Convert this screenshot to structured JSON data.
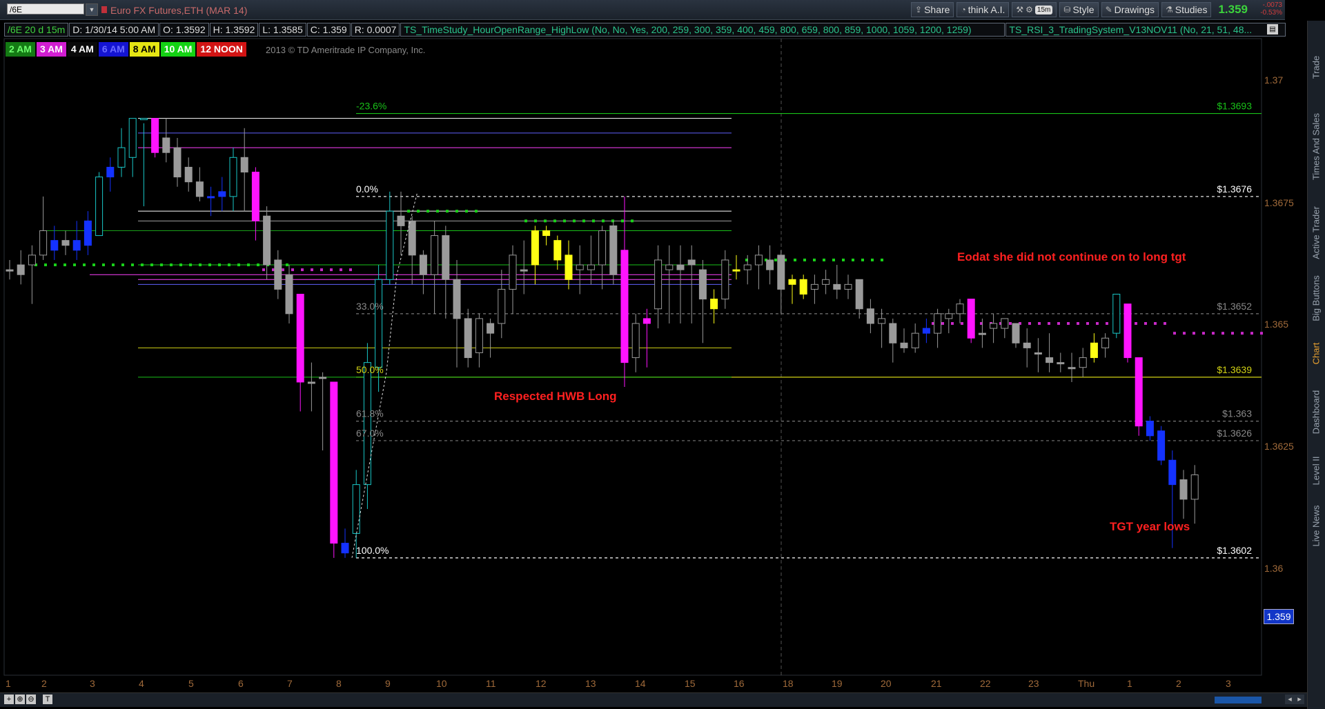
{
  "toolbar": {
    "symbol": "/6E",
    "instrument_title": "Euro FX Futures,ETH (MAR 14)",
    "share_label": "Share",
    "think_label": "think A.I.",
    "timeframe_badge": "15m",
    "style_label": "Style",
    "drawings_label": "Drawings",
    "studies_label": "Studies",
    "last_price": "1.359",
    "net_change": "-.0073",
    "pct_change": "-0.53%"
  },
  "infobar": {
    "period": "/6E 20 d 15m",
    "date": "D: 1/30/14 5:00 AM",
    "open": "O: 1.3592",
    "high": "H: 1.3592",
    "low": "L: 1.3585",
    "close": "C: 1.359",
    "range": "R: 0.0007",
    "study1": "TS_TimeStudy_HourOpenRange_HighLow (No, No, Yes, 200, 259, 300, 359, 400, 459, 800, 659, 800, 859, 1000, 1059, 1200, 1259)",
    "study2": "TS_RSI_3_TradingSystem_V13NOV11 (No, 21, 51, 48..."
  },
  "sessions": [
    {
      "label": "2 AM",
      "bg": "#147a14",
      "fg": "#6dff6d"
    },
    {
      "label": "3 AM",
      "bg": "#d21ed2",
      "fg": "#ffffff"
    },
    {
      "label": "4 AM",
      "bg": "#0a0a0a",
      "fg": "#ffffff"
    },
    {
      "label": "6 AM",
      "bg": "#1414d2",
      "fg": "#6a6aff"
    },
    {
      "label": "8 AM",
      "bg": "#e6e614",
      "fg": "#000000"
    },
    {
      "label": "10 AM",
      "bg": "#14d214",
      "fg": "#ffffff"
    },
    {
      "label": "12 NOON",
      "bg": "#d21414",
      "fg": "#ffffff"
    }
  ],
  "copyright": "2013 © TD Ameritrade IP Company, Inc.",
  "colors": {
    "up_candle": "#19c8c8",
    "down_candle": "#ff14ff",
    "neutral_candle": "#9a9a9a",
    "yellow_candle": "#ffff14",
    "blue_candle": "#1432ff",
    "fib_green": "#19c219",
    "fib_yellow": "#d2d214",
    "annotation_red": "#ff2020",
    "axis_text": "#a06a3a"
  },
  "fib_labels": {
    "ext": "-23.6%",
    "zero": "0.0%",
    "p33": "33.0%",
    "p50": "50.0%",
    "p618": "61.8%",
    "p67": "67.0%",
    "p100": "100.0%"
  },
  "fib_prices": {
    "ext": "$1.3693",
    "zero": "$1.3676",
    "p33": "$1.3652",
    "p50": "$1.3639",
    "p618": "$1.363",
    "p67": "$1.3626",
    "p100": "$1.3602"
  },
  "annotations": {
    "hwb": "Respected HWB Long",
    "eodat": "Eodat she did not continue on to long tgt",
    "tgt": "TGT year lows"
  },
  "price_axis": [
    "1.37",
    "1.3675",
    "1.365",
    "1.3625",
    "1.36"
  ],
  "price_tag": "1.359",
  "x_axis": [
    "1",
    "2",
    "3",
    "4",
    "5",
    "6",
    "7",
    "8",
    "9",
    "10",
    "11",
    "12",
    "13",
    "14",
    "15",
    "16",
    "18",
    "19",
    "20",
    "21",
    "22",
    "23",
    "Thu",
    "1",
    "2",
    "3"
  ],
  "right_tabs": [
    "Trade",
    "Times And Sales",
    "Active Trader",
    "Big Buttons",
    "Chart",
    "Dashboard",
    "Level II",
    "Live News"
  ],
  "bottom_buttons": [
    "+",
    "⊕",
    "⊖",
    "T"
  ],
  "chart_data": {
    "type": "candlestick",
    "ylim": [
      1.3578,
      1.3715
    ],
    "candles": [
      {
        "o": 1.3661,
        "h": 1.3663,
        "l": 1.3659,
        "c": 1.3661,
        "col": "n"
      },
      {
        "o": 1.3662,
        "h": 1.3665,
        "l": 1.3658,
        "c": 1.366,
        "col": "n"
      },
      {
        "o": 1.3662,
        "h": 1.3666,
        "l": 1.3654,
        "c": 1.3664,
        "col": "n"
      },
      {
        "o": 1.3664,
        "h": 1.3676,
        "l": 1.3663,
        "c": 1.3669,
        "col": "n"
      },
      {
        "o": 1.3665,
        "h": 1.367,
        "l": 1.3663,
        "c": 1.3667,
        "col": "b"
      },
      {
        "o": 1.3667,
        "h": 1.3669,
        "l": 1.3664,
        "c": 1.3666,
        "col": "n"
      },
      {
        "o": 1.3665,
        "h": 1.3671,
        "l": 1.3663,
        "c": 1.3667,
        "col": "b"
      },
      {
        "o": 1.3666,
        "h": 1.3673,
        "l": 1.3664,
        "c": 1.3671,
        "col": "b"
      },
      {
        "o": 1.3668,
        "h": 1.3681,
        "l": 1.3668,
        "c": 1.368,
        "col": "u"
      },
      {
        "o": 1.368,
        "h": 1.3684,
        "l": 1.3677,
        "c": 1.3682,
        "col": "b"
      },
      {
        "o": 1.3682,
        "h": 1.369,
        "l": 1.368,
        "c": 1.3686,
        "col": "u"
      },
      {
        "o": 1.3684,
        "h": 1.3692,
        "l": 1.368,
        "c": 1.3692,
        "col": "u"
      },
      {
        "o": 1.3692,
        "h": 1.3691,
        "l": 1.3674,
        "c": 1.3692,
        "col": "u"
      },
      {
        "o": 1.3692,
        "h": 1.3692,
        "l": 1.3684,
        "c": 1.3685,
        "col": "d"
      },
      {
        "o": 1.3688,
        "h": 1.3692,
        "l": 1.3683,
        "c": 1.3685,
        "col": "n"
      },
      {
        "o": 1.3686,
        "h": 1.3688,
        "l": 1.3678,
        "c": 1.368,
        "col": "n"
      },
      {
        "o": 1.3682,
        "h": 1.3684,
        "l": 1.3677,
        "c": 1.3679,
        "col": "n"
      },
      {
        "o": 1.3679,
        "h": 1.3682,
        "l": 1.3675,
        "c": 1.3676,
        "col": "n"
      },
      {
        "o": 1.3676,
        "h": 1.3678,
        "l": 1.3672,
        "c": 1.3676,
        "col": "b"
      },
      {
        "o": 1.3676,
        "h": 1.368,
        "l": 1.3673,
        "c": 1.3677,
        "col": "b"
      },
      {
        "o": 1.3676,
        "h": 1.3686,
        "l": 1.3673,
        "c": 1.3684,
        "col": "u"
      },
      {
        "o": 1.3684,
        "h": 1.369,
        "l": 1.3673,
        "c": 1.3681,
        "col": "n"
      },
      {
        "o": 1.3681,
        "h": 1.3682,
        "l": 1.3667,
        "c": 1.3671,
        "col": "d"
      },
      {
        "o": 1.3672,
        "h": 1.3674,
        "l": 1.3659,
        "c": 1.3662,
        "col": "n"
      },
      {
        "o": 1.3663,
        "h": 1.3665,
        "l": 1.3655,
        "c": 1.3657,
        "col": "n"
      },
      {
        "o": 1.366,
        "h": 1.3662,
        "l": 1.365,
        "c": 1.3652,
        "col": "n"
      },
      {
        "o": 1.3656,
        "h": 1.3656,
        "l": 1.3632,
        "c": 1.3638,
        "col": "d"
      },
      {
        "o": 1.3638,
        "h": 1.3642,
        "l": 1.3632,
        "c": 1.3638,
        "col": "n"
      },
      {
        "o": 1.3639,
        "h": 1.364,
        "l": 1.3624,
        "c": 1.3639,
        "col": "n"
      },
      {
        "o": 1.3638,
        "h": 1.3638,
        "l": 1.3602,
        "c": 1.3605,
        "col": "d"
      },
      {
        "o": 1.3603,
        "h": 1.3608,
        "l": 1.3602,
        "c": 1.3605,
        "col": "b"
      },
      {
        "o": 1.3607,
        "h": 1.362,
        "l": 1.3602,
        "c": 1.3617,
        "col": "u"
      },
      {
        "o": 1.3617,
        "h": 1.3646,
        "l": 1.3612,
        "c": 1.3642,
        "col": "u"
      },
      {
        "o": 1.3641,
        "h": 1.3662,
        "l": 1.3636,
        "c": 1.3659,
        "col": "u"
      },
      {
        "o": 1.3659,
        "h": 1.3677,
        "l": 1.3658,
        "c": 1.3673,
        "col": "u"
      },
      {
        "o": 1.3672,
        "h": 1.3677,
        "l": 1.3664,
        "c": 1.367,
        "col": "n"
      },
      {
        "o": 1.3671,
        "h": 1.3672,
        "l": 1.3658,
        "c": 1.3664,
        "col": "n"
      },
      {
        "o": 1.3664,
        "h": 1.3665,
        "l": 1.3656,
        "c": 1.366,
        "col": "n"
      },
      {
        "o": 1.366,
        "h": 1.3671,
        "l": 1.3652,
        "c": 1.3668,
        "col": "n"
      },
      {
        "o": 1.3668,
        "h": 1.367,
        "l": 1.3651,
        "c": 1.3659,
        "col": "n"
      },
      {
        "o": 1.3659,
        "h": 1.3663,
        "l": 1.3641,
        "c": 1.3651,
        "col": "n"
      },
      {
        "o": 1.3651,
        "h": 1.3653,
        "l": 1.3641,
        "c": 1.3643,
        "col": "n"
      },
      {
        "o": 1.3644,
        "h": 1.3652,
        "l": 1.3641,
        "c": 1.3651,
        "col": "n"
      },
      {
        "o": 1.365,
        "h": 1.3651,
        "l": 1.3643,
        "c": 1.3648,
        "col": "n"
      },
      {
        "o": 1.365,
        "h": 1.3661,
        "l": 1.3647,
        "c": 1.3657,
        "col": "n"
      },
      {
        "o": 1.3657,
        "h": 1.3666,
        "l": 1.3652,
        "c": 1.3664,
        "col": "n"
      },
      {
        "o": 1.3661,
        "h": 1.3667,
        "l": 1.3656,
        "c": 1.3661,
        "col": "n"
      },
      {
        "o": 1.3662,
        "h": 1.367,
        "l": 1.3658,
        "c": 1.3669,
        "col": "y"
      },
      {
        "o": 1.3669,
        "h": 1.367,
        "l": 1.3666,
        "c": 1.3668,
        "col": "y"
      },
      {
        "o": 1.3667,
        "h": 1.3668,
        "l": 1.3661,
        "c": 1.3663,
        "col": "y"
      },
      {
        "o": 1.3664,
        "h": 1.3667,
        "l": 1.3657,
        "c": 1.3659,
        "col": "y"
      },
      {
        "o": 1.3661,
        "h": 1.3666,
        "l": 1.3656,
        "c": 1.3662,
        "col": "n"
      },
      {
        "o": 1.3661,
        "h": 1.3668,
        "l": 1.3658,
        "c": 1.3662,
        "col": "n"
      },
      {
        "o": 1.3662,
        "h": 1.367,
        "l": 1.3657,
        "c": 1.3669,
        "col": "n"
      },
      {
        "o": 1.367,
        "h": 1.3671,
        "l": 1.3658,
        "c": 1.366,
        "col": "n"
      },
      {
        "o": 1.3665,
        "h": 1.3676,
        "l": 1.3637,
        "c": 1.3642,
        "col": "d"
      },
      {
        "o": 1.3643,
        "h": 1.3652,
        "l": 1.364,
        "c": 1.365,
        "col": "n"
      },
      {
        "o": 1.365,
        "h": 1.3653,
        "l": 1.3641,
        "c": 1.3651,
        "col": "d"
      },
      {
        "o": 1.3653,
        "h": 1.3666,
        "l": 1.3649,
        "c": 1.3663,
        "col": "n"
      },
      {
        "o": 1.3661,
        "h": 1.3666,
        "l": 1.365,
        "c": 1.3662,
        "col": "n"
      },
      {
        "o": 1.3662,
        "h": 1.3666,
        "l": 1.365,
        "c": 1.3661,
        "col": "n"
      },
      {
        "o": 1.3663,
        "h": 1.3666,
        "l": 1.365,
        "c": 1.3662,
        "col": "n"
      },
      {
        "o": 1.3661,
        "h": 1.3663,
        "l": 1.3646,
        "c": 1.3655,
        "col": "n"
      },
      {
        "o": 1.3653,
        "h": 1.3657,
        "l": 1.365,
        "c": 1.3655,
        "col": "y"
      },
      {
        "o": 1.3655,
        "h": 1.3665,
        "l": 1.3653,
        "c": 1.3663,
        "col": "n"
      },
      {
        "o": 1.3661,
        "h": 1.3664,
        "l": 1.3659,
        "c": 1.3661,
        "col": "y"
      },
      {
        "o": 1.3661,
        "h": 1.3664,
        "l": 1.3658,
        "c": 1.3662,
        "col": "n"
      },
      {
        "o": 1.3662,
        "h": 1.3666,
        "l": 1.3657,
        "c": 1.3664,
        "col": "n"
      },
      {
        "o": 1.3663,
        "h": 1.3666,
        "l": 1.3658,
        "c": 1.3661,
        "col": "n"
      },
      {
        "o": 1.3664,
        "h": 1.3665,
        "l": 1.3652,
        "c": 1.3657,
        "col": "n"
      },
      {
        "o": 1.3659,
        "h": 1.366,
        "l": 1.3654,
        "c": 1.3658,
        "col": "y"
      },
      {
        "o": 1.3659,
        "h": 1.366,
        "l": 1.3655,
        "c": 1.3656,
        "col": "y"
      },
      {
        "o": 1.3657,
        "h": 1.366,
        "l": 1.3654,
        "c": 1.3658,
        "col": "n"
      },
      {
        "o": 1.3658,
        "h": 1.3661,
        "l": 1.3656,
        "c": 1.3659,
        "col": "n"
      },
      {
        "o": 1.3658,
        "h": 1.3662,
        "l": 1.3655,
        "c": 1.3657,
        "col": "n"
      },
      {
        "o": 1.3657,
        "h": 1.366,
        "l": 1.3655,
        "c": 1.3658,
        "col": "n"
      },
      {
        "o": 1.3659,
        "h": 1.3659,
        "l": 1.3651,
        "c": 1.3653,
        "col": "n"
      },
      {
        "o": 1.3653,
        "h": 1.3655,
        "l": 1.3648,
        "c": 1.365,
        "col": "n"
      },
      {
        "o": 1.365,
        "h": 1.3653,
        "l": 1.3645,
        "c": 1.3651,
        "col": "n"
      },
      {
        "o": 1.365,
        "h": 1.3651,
        "l": 1.3642,
        "c": 1.3646,
        "col": "n"
      },
      {
        "o": 1.3646,
        "h": 1.3649,
        "l": 1.3644,
        "c": 1.3645,
        "col": "n"
      },
      {
        "o": 1.3645,
        "h": 1.365,
        "l": 1.3644,
        "c": 1.3648,
        "col": "n"
      },
      {
        "o": 1.3649,
        "h": 1.3651,
        "l": 1.3646,
        "c": 1.3648,
        "col": "b"
      },
      {
        "o": 1.3648,
        "h": 1.3653,
        "l": 1.3645,
        "c": 1.3652,
        "col": "n"
      },
      {
        "o": 1.3651,
        "h": 1.3653,
        "l": 1.3648,
        "c": 1.3652,
        "col": "n"
      },
      {
        "o": 1.3652,
        "h": 1.3655,
        "l": 1.365,
        "c": 1.3654,
        "col": "n"
      },
      {
        "o": 1.3655,
        "h": 1.3655,
        "l": 1.3646,
        "c": 1.3647,
        "col": "d"
      },
      {
        "o": 1.3648,
        "h": 1.3651,
        "l": 1.3645,
        "c": 1.3648,
        "col": "n"
      },
      {
        "o": 1.3649,
        "h": 1.3652,
        "l": 1.3646,
        "c": 1.365,
        "col": "n"
      },
      {
        "o": 1.3649,
        "h": 1.3651,
        "l": 1.3647,
        "c": 1.3651,
        "col": "n"
      },
      {
        "o": 1.365,
        "h": 1.365,
        "l": 1.3645,
        "c": 1.3646,
        "col": "n"
      },
      {
        "o": 1.3646,
        "h": 1.3649,
        "l": 1.3641,
        "c": 1.3645,
        "col": "n"
      },
      {
        "o": 1.3644,
        "h": 1.3647,
        "l": 1.364,
        "c": 1.3644,
        "col": "n"
      },
      {
        "o": 1.3643,
        "h": 1.3648,
        "l": 1.364,
        "c": 1.3642,
        "col": "n"
      },
      {
        "o": 1.3642,
        "h": 1.3644,
        "l": 1.364,
        "c": 1.3642,
        "col": "n"
      },
      {
        "o": 1.3641,
        "h": 1.3644,
        "l": 1.3638,
        "c": 1.3641,
        "col": "n"
      },
      {
        "o": 1.3641,
        "h": 1.3645,
        "l": 1.3639,
        "c": 1.3643,
        "col": "n"
      },
      {
        "o": 1.3643,
        "h": 1.3648,
        "l": 1.3642,
        "c": 1.3646,
        "col": "y"
      },
      {
        "o": 1.3645,
        "h": 1.3648,
        "l": 1.3643,
        "c": 1.3647,
        "col": "n"
      },
      {
        "o": 1.3648,
        "h": 1.3656,
        "l": 1.3647,
        "c": 1.3656,
        "col": "u"
      },
      {
        "o": 1.3654,
        "h": 1.3654,
        "l": 1.3642,
        "c": 1.3643,
        "col": "d"
      },
      {
        "o": 1.3643,
        "h": 1.3643,
        "l": 1.3627,
        "c": 1.3629,
        "col": "d"
      },
      {
        "o": 1.363,
        "h": 1.3631,
        "l": 1.3626,
        "c": 1.3627,
        "col": "b"
      },
      {
        "o": 1.3628,
        "h": 1.3629,
        "l": 1.3621,
        "c": 1.3622,
        "col": "b"
      },
      {
        "o": 1.3622,
        "h": 1.3624,
        "l": 1.3604,
        "c": 1.3617,
        "col": "b"
      },
      {
        "o": 1.3618,
        "h": 1.362,
        "l": 1.361,
        "c": 1.3614,
        "col": "n"
      },
      {
        "o": 1.3614,
        "h": 1.3621,
        "l": 1.3609,
        "c": 1.3619,
        "col": "n"
      }
    ]
  }
}
